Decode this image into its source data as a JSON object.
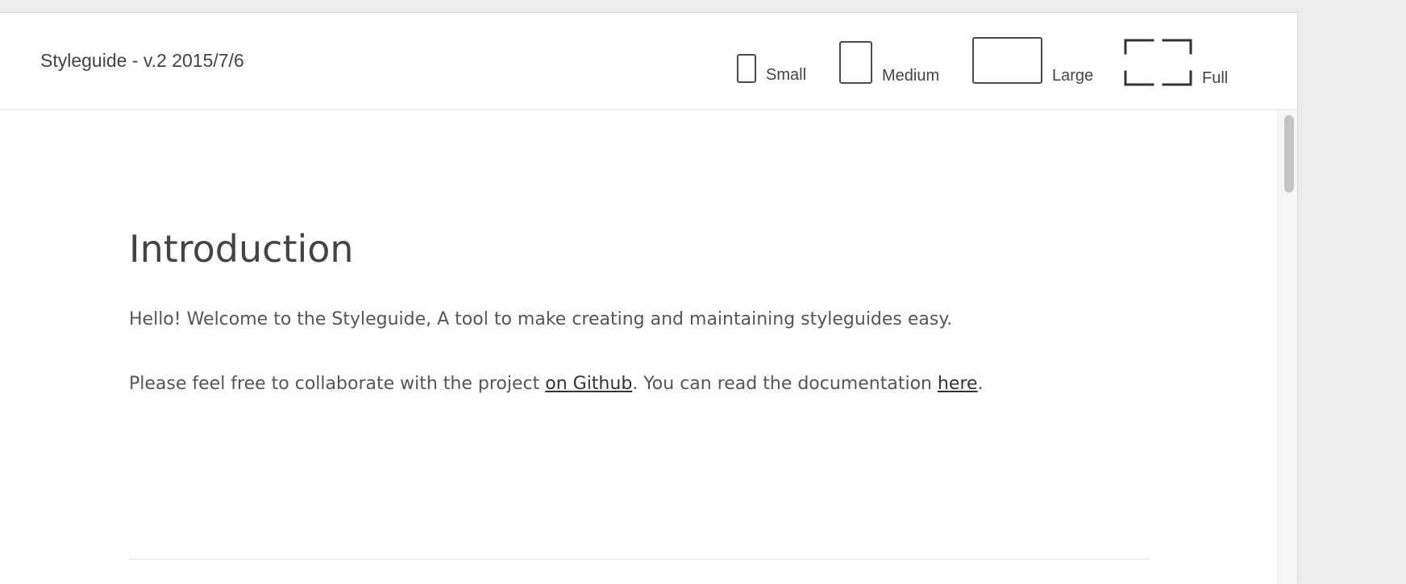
{
  "header": {
    "title": "Styleguide - v.2 2015/7/6",
    "size_options": [
      {
        "label": "Small",
        "icon": "small-viewport-icon"
      },
      {
        "label": "Medium",
        "icon": "medium-viewport-icon"
      },
      {
        "label": "Large",
        "icon": "large-viewport-icon"
      },
      {
        "label": "Full",
        "icon": "fullscreen-icon"
      }
    ]
  },
  "content": {
    "heading": "Introduction",
    "paragraph1": "Hello! Welcome to the Styleguide, A tool to make creating and maintaining styleguides easy.",
    "paragraph2": {
      "before_link1": "Please feel free to collaborate with the project ",
      "link1": "on Github",
      "between": ". You can read the documentation ",
      "link2": "here",
      "after": "."
    }
  },
  "colors": {
    "background": "#ececec",
    "surface": "#ffffff",
    "text": "#4a4a4a"
  }
}
